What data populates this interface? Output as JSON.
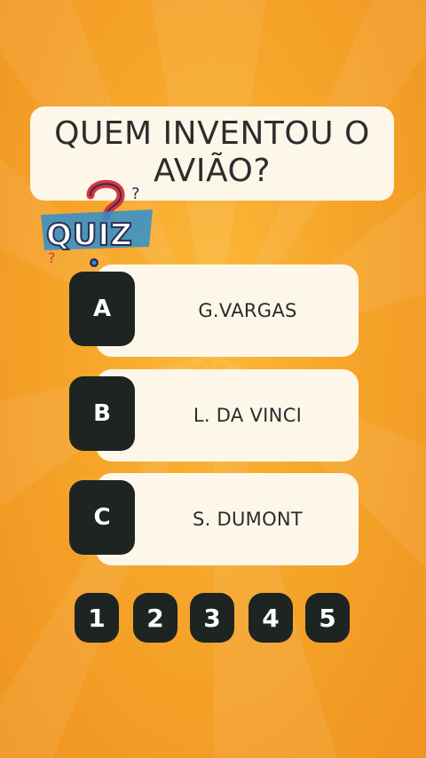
{
  "question": {
    "line1": "QUEM INVENTOU O",
    "line2": "AVIÃO?"
  },
  "logo": {
    "text": "QUIZ",
    "colors": {
      "blue": "#2f8fcf",
      "red": "#d9343a",
      "dark": "#2a2f55"
    }
  },
  "answers": [
    {
      "letter": "A",
      "text": "G.VARGAS"
    },
    {
      "letter": "B",
      "text": "L. DA VINCI"
    },
    {
      "letter": "C",
      "text": "S. DUMONT"
    }
  ],
  "numbers": [
    "1",
    "2",
    "3",
    "4",
    "5"
  ],
  "colors": {
    "background": "#f6a52a",
    "card": "#fdf7ea",
    "badge": "#1d2421",
    "badge_text": "#ffffff"
  }
}
